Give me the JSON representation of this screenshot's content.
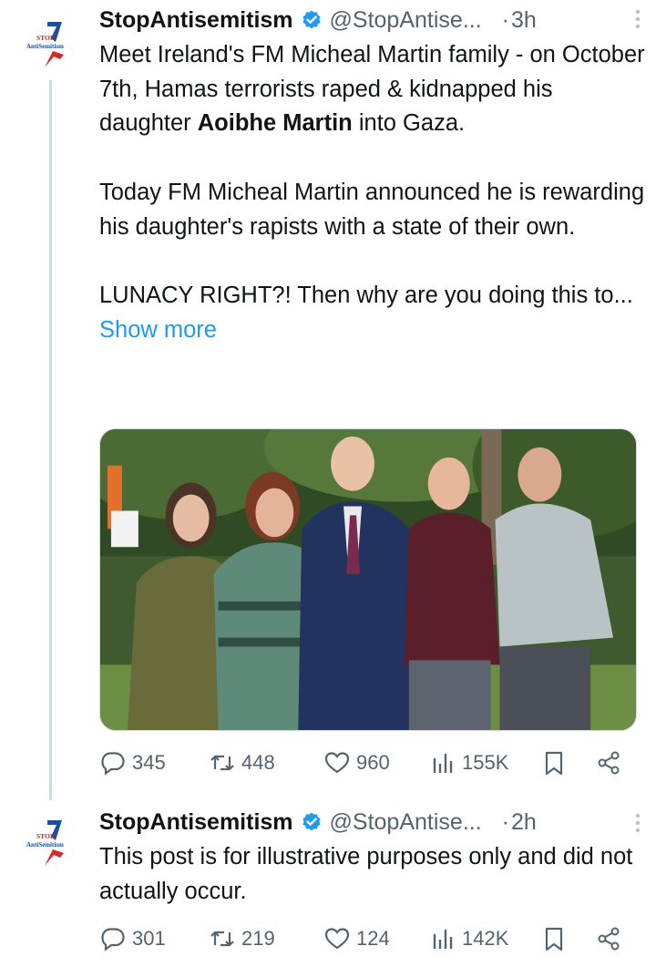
{
  "tweets": [
    {
      "author": {
        "name": "StopAntisemitism",
        "handle": "@StopAntise...",
        "avatar_text_top": "STOP",
        "avatar_text_bottom": "AntiSemitism"
      },
      "time": "3h",
      "dot": "·",
      "text": {
        "p1_before": "Meet Ireland's FM Micheal Martin family - on October 7th, Hamas terrorists raped & kidnapped his daughter ",
        "p1_bold": "Aoibhe Martin",
        "p1_after": " into Gaza.",
        "p2": "Today FM Micheal Martin announced he is rewarding his daughter's rapists with a state of their own.",
        "p3": "LUNACY RIGHT?! Then why are you doing this to...",
        "show_more": "Show more"
      },
      "stats": {
        "replies": "345",
        "reposts": "448",
        "likes": "960",
        "views": "155K"
      }
    },
    {
      "author": {
        "name": "StopAntisemitism",
        "handle": "@StopAntise...",
        "avatar_text_top": "STOP",
        "avatar_text_bottom": "AntiSemitism"
      },
      "time": "2h",
      "dot": "·",
      "text": {
        "p1": "This post is for illustrative purposes only and did not actually occur."
      },
      "stats": {
        "replies": "301",
        "reposts": "219",
        "likes": "124",
        "views": "142K"
      }
    }
  ],
  "icons": {
    "verified": "verified-badge-icon",
    "more": "more-options-icon",
    "reply": "reply-icon",
    "repost": "repost-icon",
    "like": "heart-icon",
    "views": "views-chart-icon",
    "bookmark": "bookmark-icon",
    "share": "share-icon"
  },
  "colors": {
    "accent": "#1d9bf0",
    "text": "#0f1419",
    "secondary": "#536471",
    "logo_blue": "#1d4fa0",
    "logo_red": "#d62828"
  }
}
